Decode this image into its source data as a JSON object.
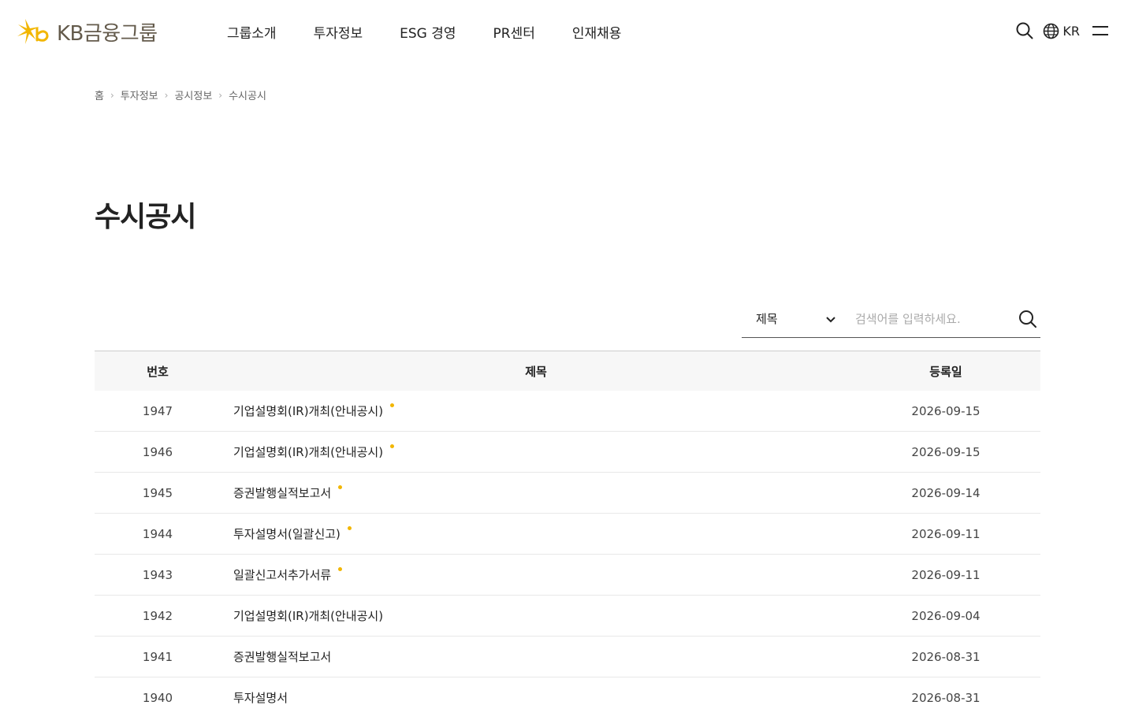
{
  "header": {
    "logo_text": "KB금융그룹",
    "logo_icon": "kb-star-logo",
    "brand_color": "#f2b600",
    "logo_text_color": "#645b4c",
    "nav": [
      "그룹소개",
      "투자정보",
      "ESG 경영",
      "PR센터",
      "인재채용"
    ],
    "lang": "KR",
    "icons": {
      "search": "search-icon",
      "lang": "globe-icon",
      "menu": "hamburger-menu-icon"
    }
  },
  "breadcrumb": [
    "홈",
    "투자정보",
    "공시정보",
    "수시공시"
  ],
  "page_title": "수시공시",
  "search": {
    "select_value": "제목",
    "placeholder": "검색어를 입력하세요."
  },
  "table": {
    "headers": {
      "num": "번호",
      "title": "제목",
      "date": "등록일"
    },
    "rows": [
      {
        "num": "1947",
        "title": "기업설명회(IR)개최(안내공시)",
        "date": "2026-09-15",
        "new": true
      },
      {
        "num": "1946",
        "title": "기업설명회(IR)개최(안내공시)",
        "date": "2026-09-15",
        "new": true
      },
      {
        "num": "1945",
        "title": "증권발행실적보고서",
        "date": "2026-09-14",
        "new": true
      },
      {
        "num": "1944",
        "title": "투자설명서(일괄신고)",
        "date": "2026-09-11",
        "new": true
      },
      {
        "num": "1943",
        "title": "일괄신고서추가서류",
        "date": "2026-09-11",
        "new": true
      },
      {
        "num": "1942",
        "title": "기업설명회(IR)개최(안내공시)",
        "date": "2026-09-04",
        "new": false
      },
      {
        "num": "1941",
        "title": "증권발행실적보고서",
        "date": "2026-08-31",
        "new": false
      },
      {
        "num": "1940",
        "title": "투자설명서",
        "date": "2026-08-31",
        "new": false
      }
    ]
  }
}
